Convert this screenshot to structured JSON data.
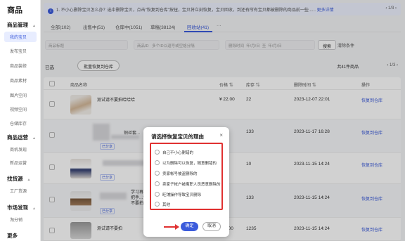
{
  "sidebar": {
    "brand": "商品",
    "sections": [
      {
        "title": "商品管理",
        "items": [
          "我的宝贝",
          "发布宝贝",
          "商品装修",
          "商品素材",
          "图片空间",
          "视频空间",
          "仓储库存"
        ]
      },
      {
        "title": "商品运营",
        "items": [
          "商机发现",
          "新品运营"
        ]
      },
      {
        "title": "找货源",
        "items": [
          "工厂货源"
        ]
      },
      {
        "title": "市场发现",
        "items": [
          "淘分销"
        ]
      },
      {
        "title": "更多",
        "items": []
      }
    ],
    "active_item": "我的宝贝"
  },
  "notice": {
    "text": "1. 不小心删除宝贝怎么办？选中删除宝贝，点击\"恢复到仓库\"按钮，宝贝将立刻恢复，宝贝回收，到还有所有宝贝都被删除的商品前一些......",
    "more": "更多详情",
    "pager": "‹ 1/3 ›"
  },
  "tabs": [
    {
      "label": "全部(102)"
    },
    {
      "label": "出售中(51)"
    },
    {
      "label": "仓库中(1051)"
    },
    {
      "label": "草稿(38124)"
    },
    {
      "label": "回收站(41)"
    },
    {
      "label": "···"
    }
  ],
  "filters": {
    "title_label": "商品标题",
    "id_label": "商品ID",
    "id_placeholder": "多个ID以逗号或空格分隔",
    "time_label": "删除时间",
    "date_start": "年/月/日",
    "date_sep": "至",
    "date_end": "年/月/日",
    "search": "搜索",
    "clear": "清除条件"
  },
  "toolbar": {
    "selected": "已选",
    "batch_restore": "批量恢复到仓库",
    "total": "共41件商品",
    "pager": "‹ 1/3 ›"
  },
  "table": {
    "headers": {
      "name": "商品名称",
      "price": "价格 ⇅",
      "stock": "库存 ⇅",
      "deleted": "删除时间 ⇅",
      "action": "操作"
    },
    "rows": [
      {
        "name": "测试请不要拍哈哈哈",
        "tag": "",
        "price": "¥ 22.00",
        "stock": "22",
        "deleted": "2023-12-07 22:01",
        "action": "恢复到仓库"
      },
      {
        "name": "铜丝套...",
        "tag": "已分享",
        "price": "",
        "stock": "133",
        "deleted": "2023-11-17 16:28",
        "action": "恢复到仓库"
      },
      {
        "name": "",
        "tag": "已分享",
        "price": "",
        "stock": "10",
        "deleted": "2023-11-15 14:24",
        "action": "恢复到仓库"
      },
      {
        "name": "学习再手把手...请不要拍",
        "tag": "已分享",
        "price": "",
        "stock": "133",
        "deleted": "2023-11-15 14:24",
        "action": "恢复到仓库"
      },
      {
        "name": "测试请不要拍",
        "tag": "",
        "price": "¥ 1000",
        "stock": "1235",
        "deleted": "2023-11-15 14:24",
        "action": "恢复到仓库"
      }
    ]
  },
  "modal": {
    "title": "请选择恢复宝贝的理由",
    "close": "×",
    "options": [
      "自己不小心删错的",
      "以为删除可以恢复，随意删错的",
      "卖家帐号被盗删除的",
      "卖家子帐户被离职人员恶意删除的",
      "旺铺操作导致宝贝删除",
      "其他"
    ],
    "confirm": "确定",
    "cancel": "取消"
  },
  "colors": {
    "accent": "#3b5bdb",
    "highlight": "#e03131"
  }
}
